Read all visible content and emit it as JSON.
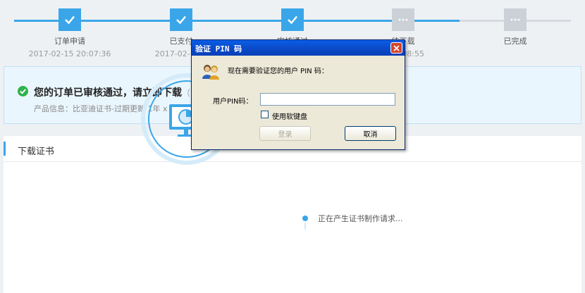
{
  "steps": [
    {
      "label": "订单申请",
      "time": "2017-02-15 20:07:36",
      "state": "done",
      "pos": 99
    },
    {
      "label": "已支付",
      "time": "2017-02-15 2",
      "state": "done",
      "pos": 257
    },
    {
      "label": "审核通过",
      "time": "",
      "state": "done",
      "pos": 415
    },
    {
      "label": "待下载",
      "time": "5 20:08:55",
      "state": "inprogress",
      "pos": 572
    },
    {
      "label": "已完成",
      "time": "",
      "state": "todo",
      "pos": 731
    }
  ],
  "notice": {
    "title": "您的订单已审核通过，请立即下载",
    "hint": "（订",
    "info": "产品信息：比亚迪证书-过期更新 1年 x 1"
  },
  "panel": {
    "title": "下载证书",
    "progress_text": "正在产生证书制作请求..."
  },
  "dialog": {
    "title": "验证 PIN 码",
    "prompt": "现在需要验证您的用户 PIN 码：",
    "pin_label": "用户PIN码：",
    "pin_value": "",
    "soft_keyboard_label": "使用软键盘",
    "login_label": "登录",
    "cancel_label": "取消"
  },
  "colors": {
    "accent": "#3aa6e9",
    "dialog_bg": "#ece9d8",
    "title_blue": "#0b49c8"
  }
}
